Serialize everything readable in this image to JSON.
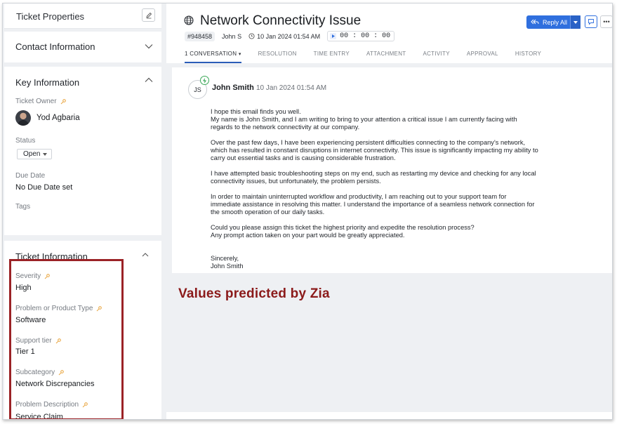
{
  "properties": {
    "title": "Ticket Properties",
    "contact_section": "Contact Information",
    "key_section": "Key Information",
    "ticket_owner_label": "Ticket Owner",
    "ticket_owner": "Yod Agbaria",
    "status_label": "Status",
    "status_value": "Open",
    "due_date_label": "Due Date",
    "due_date_value": "No Due Date set",
    "tags_label": "Tags",
    "ticket_section": "Ticket Information",
    "fields": [
      {
        "label": "Severity",
        "value": "High"
      },
      {
        "label": "Problem or Product Type",
        "value": "Software"
      },
      {
        "label": "Support tier",
        "value": "Tier 1"
      },
      {
        "label": "Subcategory",
        "value": "Network Discrepancies"
      },
      {
        "label": "Problem Description",
        "value": "Service Claim"
      }
    ]
  },
  "ticket": {
    "title": "Network Connectivity Issue",
    "id": "#948458",
    "assignee": "John S",
    "created": "10 Jan 2024 01:54 AM",
    "timer": "00 : 00 : 00",
    "reply_label": "Reply All",
    "tabs": [
      "1 CONVERSATION",
      "RESOLUTION",
      "TIME ENTRY",
      "ATTACHMENT",
      "ACTIVITY",
      "APPROVAL",
      "HISTORY"
    ]
  },
  "thread": {
    "avatar_initials": "JS",
    "sender": "John Smith",
    "time": "10 Jan 2024 01:54 AM",
    "paragraphs": [
      [
        "I hope this email finds you well.",
        "My name is John Smith, and I am writing to bring to your attention a critical issue I am currently facing with",
        "regards to the network connectivity at our company."
      ],
      [
        "Over the past few days, I have been experiencing persistent difficulties connecting to the company's network,",
        "which has resulted in constant disruptions in internet connectivity. This issue is significantly impacting my ability to",
        "carry out essential tasks and is causing considerable frustration."
      ],
      [
        "I have attempted basic troubleshooting steps on my end, such as restarting my device and checking for any local",
        "connectivity issues, but unfortunately, the problem persists."
      ],
      [
        "In order to maintain uninterrupted workflow and productivity, I am reaching out to your support team for",
        "immediate assistance in resolving this matter. I understand the importance of a seamless network connection for",
        "the smooth operation of our daily tasks."
      ],
      [
        "Could you please assign this ticket the highest priority and expedite the resolution process?",
        "Any prompt action taken on your part would be greatly appreciated."
      ]
    ],
    "signoff": [
      "Sincerely,",
      "John Smith"
    ]
  },
  "annotation": "Values predicted by Zia",
  "colors": {
    "accent": "#2f6fde",
    "highlight_border": "#9b2226",
    "annotation_text": "#8b1a1a",
    "zia_key": "#e8a33a"
  }
}
